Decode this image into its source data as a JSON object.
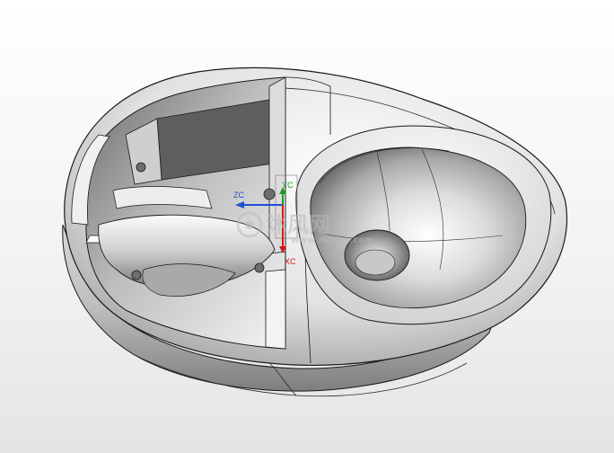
{
  "triad": {
    "zc_label": "ZC",
    "yc_label": "YC",
    "xc_label": "XC"
  },
  "watermark": {
    "logo_text": "沐风网",
    "url_text": "www.mfcad.com"
  },
  "colors": {
    "background_top": "#ffffff",
    "background_bottom": "#e4e4e4",
    "model_shade_light": "#fafafa",
    "model_shade_dark": "#8e8e8e",
    "edge_line": "#1a1a1a",
    "axis_zc": "#1f4fd6",
    "axis_yc": "#1e9a2a",
    "axis_xc": "#d01818",
    "watermark": "#c9c9c9"
  }
}
